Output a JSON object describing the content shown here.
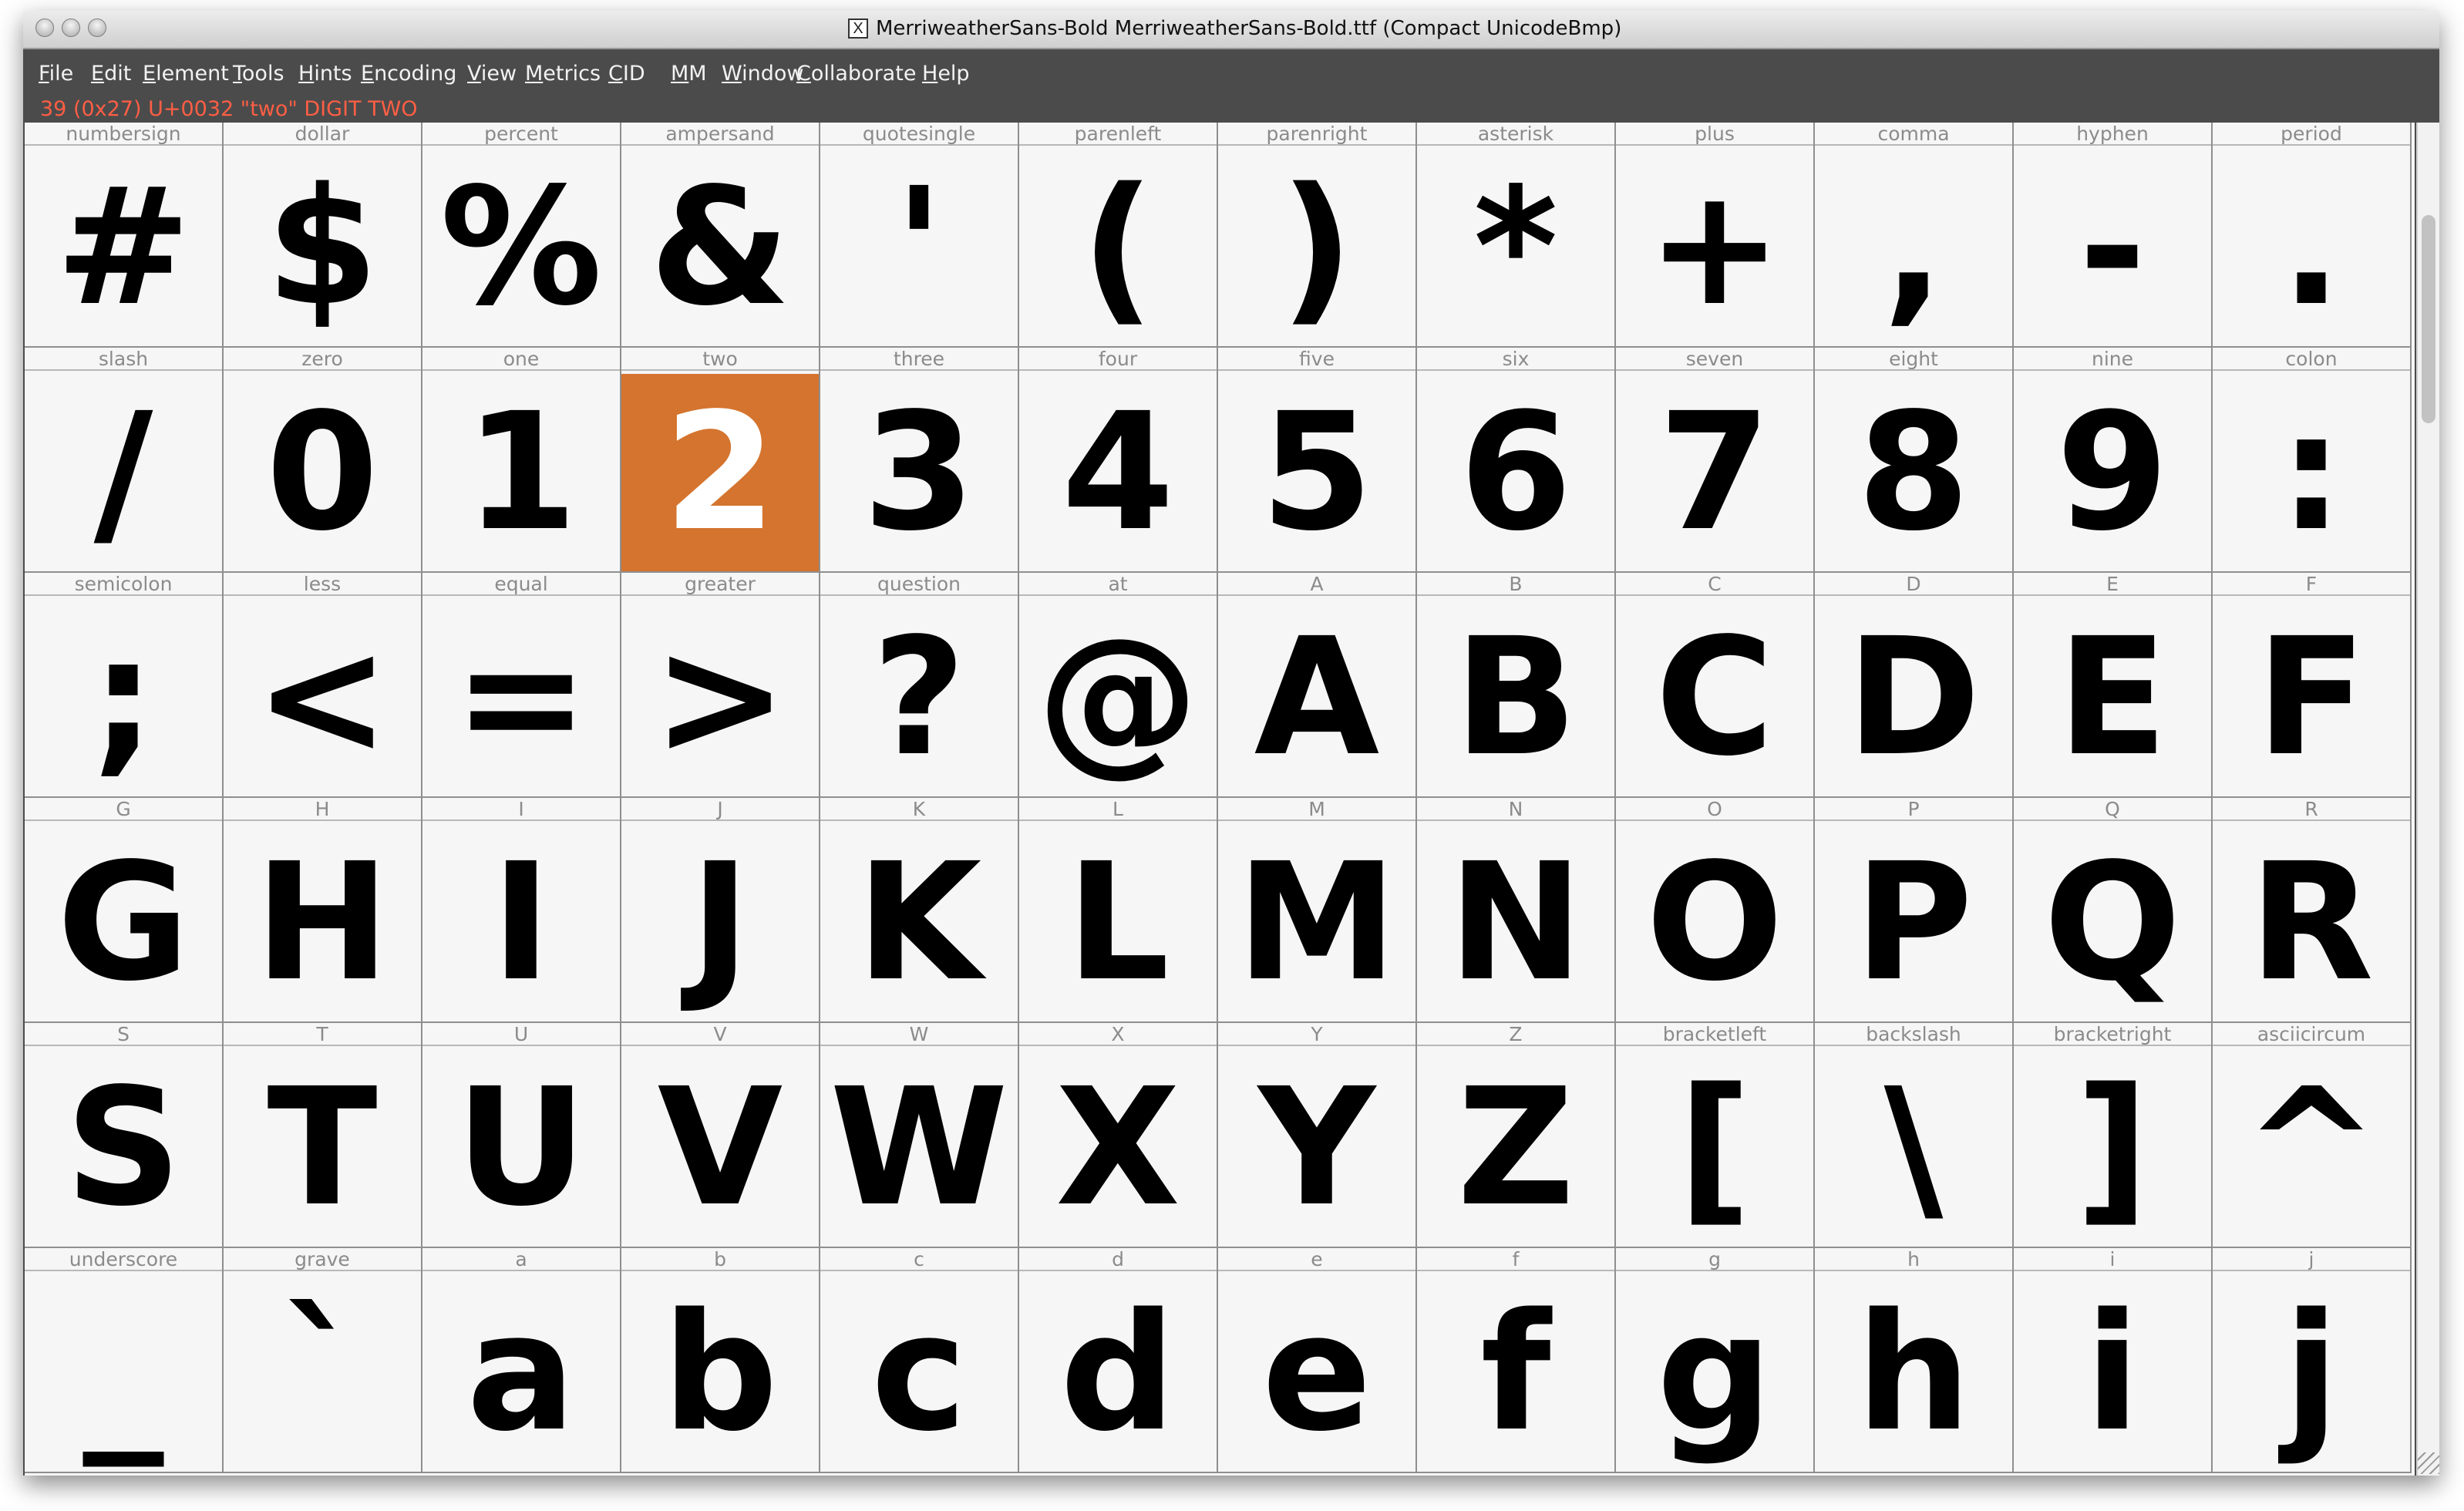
{
  "window": {
    "title": "MerriweatherSans-Bold  MerriweatherSans-Bold.ttf (Compact UnicodeBmp)",
    "x_icon": "X",
    "traffic_lights": [
      "close",
      "minimize",
      "zoom"
    ]
  },
  "menu": [
    {
      "mn": "F",
      "rest": "ile"
    },
    {
      "mn": "E",
      "rest": "dit"
    },
    {
      "mn": "E",
      "rest": "lement"
    },
    {
      "mn": "T",
      "rest": "ools"
    },
    {
      "mn": "H",
      "rest": "ints"
    },
    {
      "mn": "E",
      "rest": "ncoding"
    },
    {
      "mn": "V",
      "rest": "iew"
    },
    {
      "mn": "M",
      "rest": "etrics"
    },
    {
      "mn": "C",
      "rest": "ID"
    },
    {
      "mn": "M",
      "rest": "M"
    },
    {
      "mn": "W",
      "rest": "indow"
    },
    {
      "mn": "C",
      "rest": "ollaborate"
    },
    {
      "mn": "H",
      "rest": "elp"
    }
  ],
  "status": "39 (0x27) U+0032 \"two\" DIGIT TWO",
  "selected_glyph": "two",
  "colors": {
    "selected_bg": "#d4742e",
    "status_text": "#ff5e44",
    "menubar_bg": "#4b4b4b"
  },
  "glyphs": [
    [
      {
        "name": "numbersign",
        "char": "#"
      },
      {
        "name": "dollar",
        "char": "$"
      },
      {
        "name": "percent",
        "char": "%"
      },
      {
        "name": "ampersand",
        "char": "&"
      },
      {
        "name": "quotesingle",
        "char": "'"
      },
      {
        "name": "parenleft",
        "char": "("
      },
      {
        "name": "parenright",
        "char": ")"
      },
      {
        "name": "asterisk",
        "char": "*"
      },
      {
        "name": "plus",
        "char": "+"
      },
      {
        "name": "comma",
        "char": ","
      },
      {
        "name": "hyphen",
        "char": "-"
      },
      {
        "name": "period",
        "char": "."
      }
    ],
    [
      {
        "name": "slash",
        "char": "/"
      },
      {
        "name": "zero",
        "char": "0"
      },
      {
        "name": "one",
        "char": "1"
      },
      {
        "name": "two",
        "char": "2"
      },
      {
        "name": "three",
        "char": "3"
      },
      {
        "name": "four",
        "char": "4"
      },
      {
        "name": "five",
        "char": "5"
      },
      {
        "name": "six",
        "char": "6"
      },
      {
        "name": "seven",
        "char": "7"
      },
      {
        "name": "eight",
        "char": "8"
      },
      {
        "name": "nine",
        "char": "9"
      },
      {
        "name": "colon",
        "char": ":"
      }
    ],
    [
      {
        "name": "semicolon",
        "char": ";"
      },
      {
        "name": "less",
        "char": "<"
      },
      {
        "name": "equal",
        "char": "="
      },
      {
        "name": "greater",
        "char": ">"
      },
      {
        "name": "question",
        "char": "?"
      },
      {
        "name": "at",
        "char": "@"
      },
      {
        "name": "A",
        "char": "A"
      },
      {
        "name": "B",
        "char": "B"
      },
      {
        "name": "C",
        "char": "C"
      },
      {
        "name": "D",
        "char": "D"
      },
      {
        "name": "E",
        "char": "E"
      },
      {
        "name": "F",
        "char": "F"
      }
    ],
    [
      {
        "name": "G",
        "char": "G"
      },
      {
        "name": "H",
        "char": "H"
      },
      {
        "name": "I",
        "char": "I"
      },
      {
        "name": "J",
        "char": "J"
      },
      {
        "name": "K",
        "char": "K"
      },
      {
        "name": "L",
        "char": "L"
      },
      {
        "name": "M",
        "char": "M"
      },
      {
        "name": "N",
        "char": "N"
      },
      {
        "name": "O",
        "char": "O"
      },
      {
        "name": "P",
        "char": "P"
      },
      {
        "name": "Q",
        "char": "Q"
      },
      {
        "name": "R",
        "char": "R"
      }
    ],
    [
      {
        "name": "S",
        "char": "S"
      },
      {
        "name": "T",
        "char": "T"
      },
      {
        "name": "U",
        "char": "U"
      },
      {
        "name": "V",
        "char": "V"
      },
      {
        "name": "W",
        "char": "W"
      },
      {
        "name": "X",
        "char": "X"
      },
      {
        "name": "Y",
        "char": "Y"
      },
      {
        "name": "Z",
        "char": "Z"
      },
      {
        "name": "bracketleft",
        "char": "["
      },
      {
        "name": "backslash",
        "char": "\\"
      },
      {
        "name": "bracketright",
        "char": "]"
      },
      {
        "name": "asciicircum",
        "char": "^"
      }
    ],
    [
      {
        "name": "underscore",
        "char": "_"
      },
      {
        "name": "grave",
        "char": "`"
      },
      {
        "name": "a",
        "char": "a"
      },
      {
        "name": "b",
        "char": "b"
      },
      {
        "name": "c",
        "char": "c"
      },
      {
        "name": "d",
        "char": "d"
      },
      {
        "name": "e",
        "char": "e"
      },
      {
        "name": "f",
        "char": "f"
      },
      {
        "name": "g",
        "char": "g"
      },
      {
        "name": "h",
        "char": "h"
      },
      {
        "name": "i",
        "char": "i"
      },
      {
        "name": "j",
        "char": "j"
      }
    ]
  ]
}
